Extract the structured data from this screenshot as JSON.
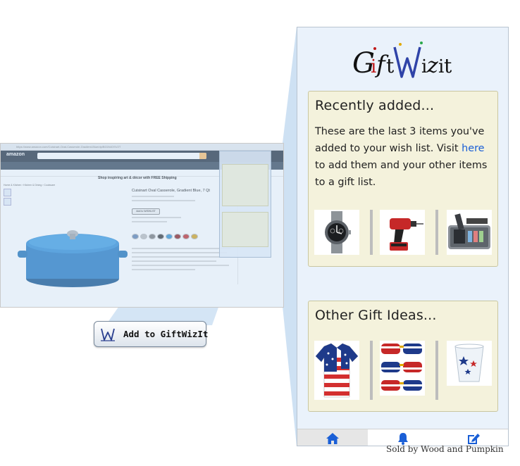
{
  "background_page": {
    "browser_url": "https://www.amazon.com/Cuisinart-Oval-Casserole-Gradient-Blue/dp/B01N4OSV2T",
    "logo_text": "amazon",
    "banner_text": "Shop inspiring art & décor with FREE Shipping",
    "breadcrumb": "Home & Kitchen › Kitchen & Dining › Cookware",
    "product_title": "Cuisinart Oval Casserole, Gradient Blue, 7 Qt",
    "add_button": "Add to WISHLIST"
  },
  "add_button": {
    "label": "Add to GiftWizIt",
    "icon": "w-logo-icon"
  },
  "panel": {
    "logo_text": "GiftWizit",
    "recently_added": {
      "title": "Recently added...",
      "text_before_link": "These are the last 3 items you've added to your wish list. Visit ",
      "link_text": "here",
      "text_after_link": " to add them and your other items to a gift list.",
      "items": [
        {
          "name": "watch",
          "icon": "watch-icon"
        },
        {
          "name": "drill",
          "icon": "drill-icon"
        },
        {
          "name": "microscope-kit",
          "icon": "microscope-icon"
        }
      ]
    },
    "other_ideas": {
      "title": "Other Gift Ideas...",
      "items": [
        {
          "name": "flag-shirt",
          "icon": "shirt-icon"
        },
        {
          "name": "flag-sunglasses",
          "icon": "sunglasses-icon"
        },
        {
          "name": "star-cups",
          "icon": "cup-icon"
        }
      ]
    },
    "tabs": [
      {
        "name": "home",
        "icon": "home-icon",
        "active": true
      },
      {
        "name": "notifications",
        "icon": "bell-icon",
        "active": false
      },
      {
        "name": "edit",
        "icon": "edit-icon",
        "active": false
      }
    ]
  },
  "underlying_text": "Sold by Wood and Pumpkin",
  "colors": {
    "panel_bg": "#eaf2fb",
    "box_bg": "#f4f2dc",
    "accent_blue": "#1a5fd6",
    "beam": "#bcd6ee"
  }
}
